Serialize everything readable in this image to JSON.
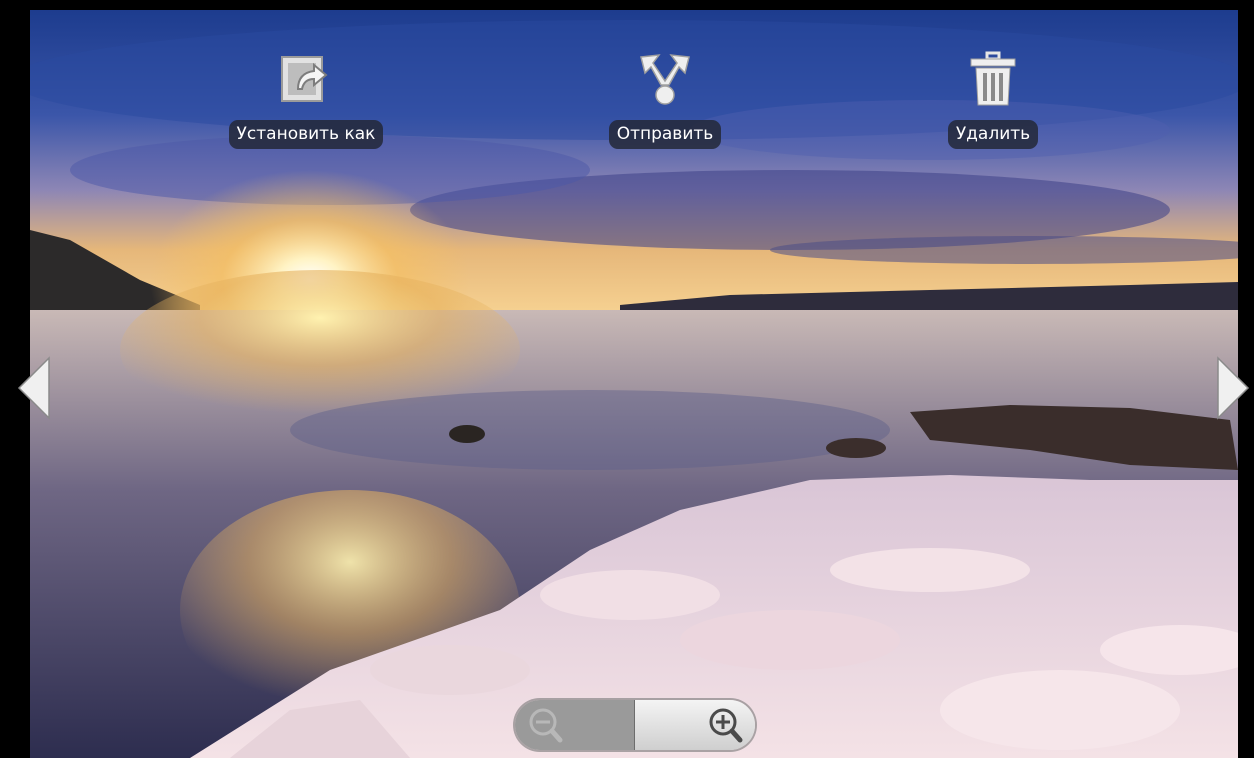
{
  "actions": {
    "set_as": {
      "label": "Установить как",
      "icon": "set-as-icon"
    },
    "share": {
      "label": "Отправить",
      "icon": "share-icon"
    },
    "delete": {
      "label": "Удалить",
      "icon": "trash-icon"
    }
  },
  "navigation": {
    "previous_icon": "chevron-left-icon",
    "next_icon": "chevron-right-icon"
  },
  "zoom": {
    "zoom_out_icon": "zoom-out-icon",
    "zoom_in_icon": "zoom-in-icon",
    "zoom_out_enabled": false,
    "zoom_in_enabled": true
  },
  "photo": {
    "scene": "sunset over icy shore"
  }
}
